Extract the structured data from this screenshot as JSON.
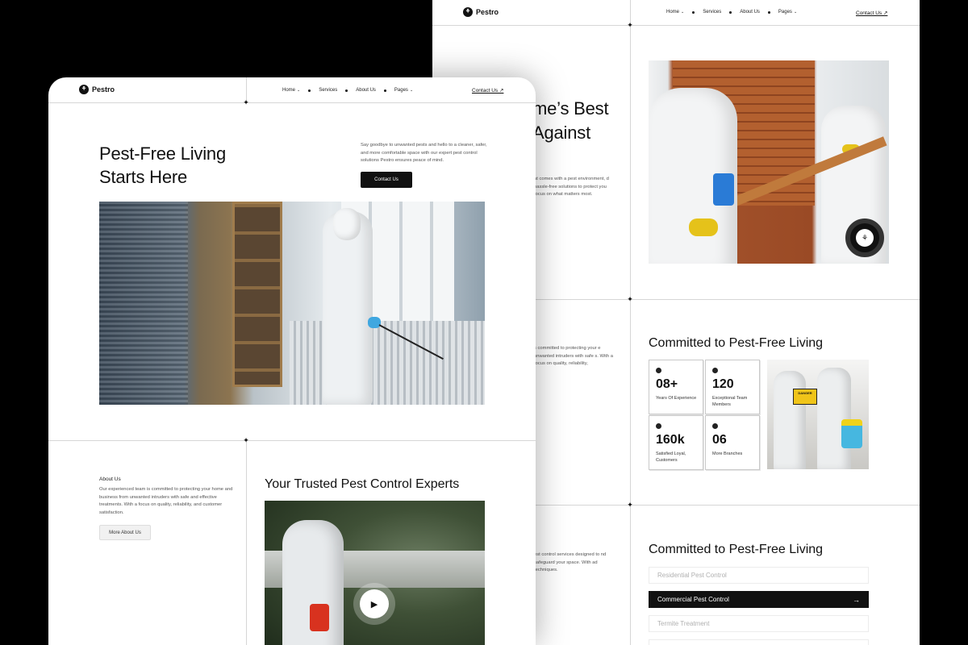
{
  "brand": {
    "name": "Pestro",
    "mark": "⚘"
  },
  "nav": {
    "items": [
      {
        "label": "Home",
        "dropdown": true
      },
      {
        "label": "Services",
        "dropdown": false
      },
      {
        "label": "About Us",
        "dropdown": false
      },
      {
        "label": "Pages",
        "dropdown": true
      }
    ],
    "contact": "Contact Us ↗"
  },
  "back": {
    "hero_title_fragment_1": "me’s Best",
    "hero_title_fragment_2": "Against",
    "hero_text_fragment": "at comes with a pest environment, d hassle-free solutions to protect you focus on what matters most.",
    "about_text_fragment": "s committed to protecting your e unwanted intruders with safe s. With a focus on quality, reliability,",
    "stats_title": "Committed to Pest-Free Living",
    "stats": [
      {
        "value": "08+",
        "caption": "Years Of Experience"
      },
      {
        "value": "120",
        "caption": "Exceptional Team Members"
      },
      {
        "value": "160k",
        "caption": "Satisfied Loyal, Customers"
      },
      {
        "value": "06",
        "caption": "More Branches"
      }
    ],
    "team_photo_sign": "DANGER",
    "services_text_fragment": "est control services designed to nd safeguard your space. With ad techniques.",
    "services_title": "Committed to Pest-Free Living",
    "services": [
      {
        "label": "Residential Pest Control",
        "active": false
      },
      {
        "label": "Commercial Pest Control",
        "active": true
      },
      {
        "label": "Termite Treatment",
        "active": false
      }
    ],
    "arrow": "→"
  },
  "front": {
    "hero_title_line1": "Pest-Free Living",
    "hero_title_line2": "Starts Here",
    "hero_text": "Say goodbye to unwanted pests and hello to a cleaner, safer, and more comfortable space with our expert pest control solutions Pestro ensures peace of mind.",
    "hero_button": "Contact Us",
    "about_label": "About Us",
    "about_text": "Our experienced team is committed to protecting your home and business from unwanted intruders with safe and effective treatments. With a focus on quality, reliability, and customer satisfaction.",
    "about_button": "More About Us",
    "experts_title": "Your Trusted Pest Control Experts"
  },
  "icons": {
    "play": "▶",
    "star": "✦",
    "chevron": "⌄"
  }
}
